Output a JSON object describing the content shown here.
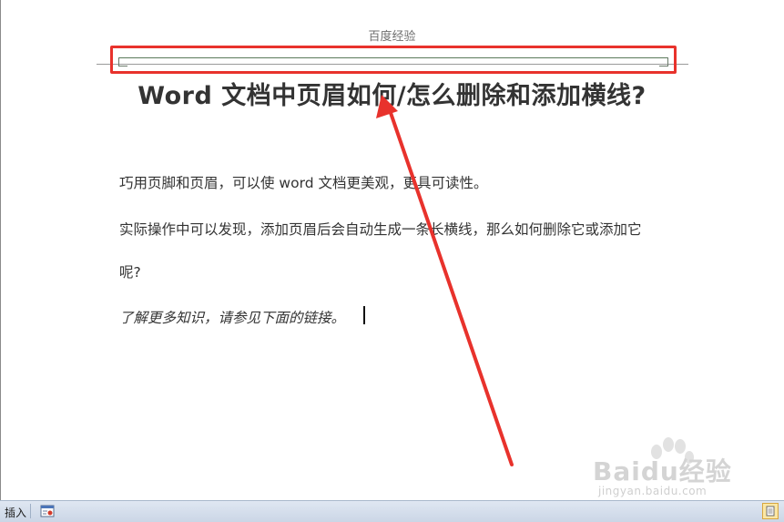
{
  "page": {
    "header_text": "百度经验",
    "title": "Word 文档中页眉如何/怎么删除和添加横线?",
    "paragraphs": [
      "巧用页脚和页眉，可以使 word 文档更美观，更具可读性。",
      "实际操作中可以发现，添加页眉后会自动生成一条长横线，那么如何删除它或添加它",
      "呢?",
      "了解更多知识，请参见下面的链接。"
    ]
  },
  "annotation": {
    "highlight_color": "#e8322c"
  },
  "watermark": {
    "logo": "Baidu经验",
    "url": "jingyan.baidu.com"
  },
  "statusbar": {
    "mode_label": "插入",
    "macro_icon": "macro-record-icon",
    "view_icon": "print-layout-view-icon"
  }
}
